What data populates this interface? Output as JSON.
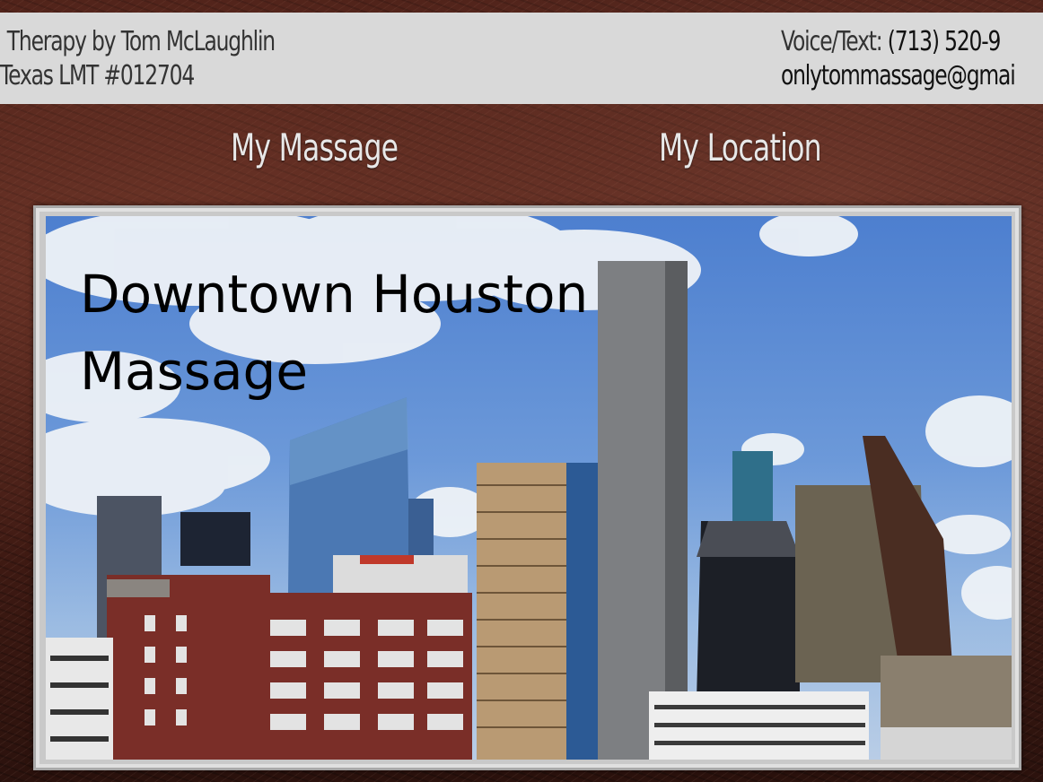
{
  "header": {
    "brand_line1": "Therapy by Tom McLaughlin",
    "brand_line2": "Texas LMT #012704",
    "contact_prefix": "Voice/Text: ",
    "phone": "(713) 520-9",
    "email": "onlytommassage@gmai"
  },
  "nav": {
    "items": [
      {
        "label": "My Massage"
      },
      {
        "label": "My Location"
      }
    ]
  },
  "hero": {
    "title_line1": "Downtown Houston",
    "title_line2": "Massage",
    "image_alt": "Downtown Houston skyline"
  },
  "colors": {
    "topbar": "#d9d9d9",
    "nav_text": "#e8e8e8",
    "frame": "#c9c9c9"
  }
}
